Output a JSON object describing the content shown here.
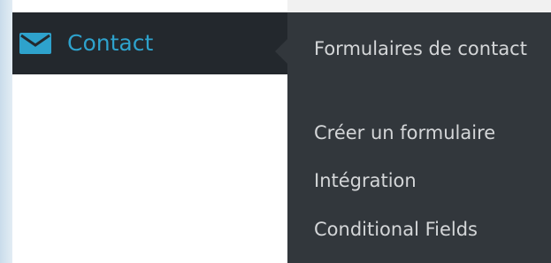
{
  "menu": {
    "label": "Contact",
    "icon": "mail-icon",
    "label_color": "#2ea2cc"
  },
  "submenu": {
    "items": [
      "Formulaires de contact",
      "Créer un formulaire",
      "Intégration",
      "Conditional Fields"
    ]
  },
  "colors": {
    "menu_bg": "#23282d",
    "submenu_bg": "#32373c",
    "submenu_text": "#d4d6d8"
  }
}
